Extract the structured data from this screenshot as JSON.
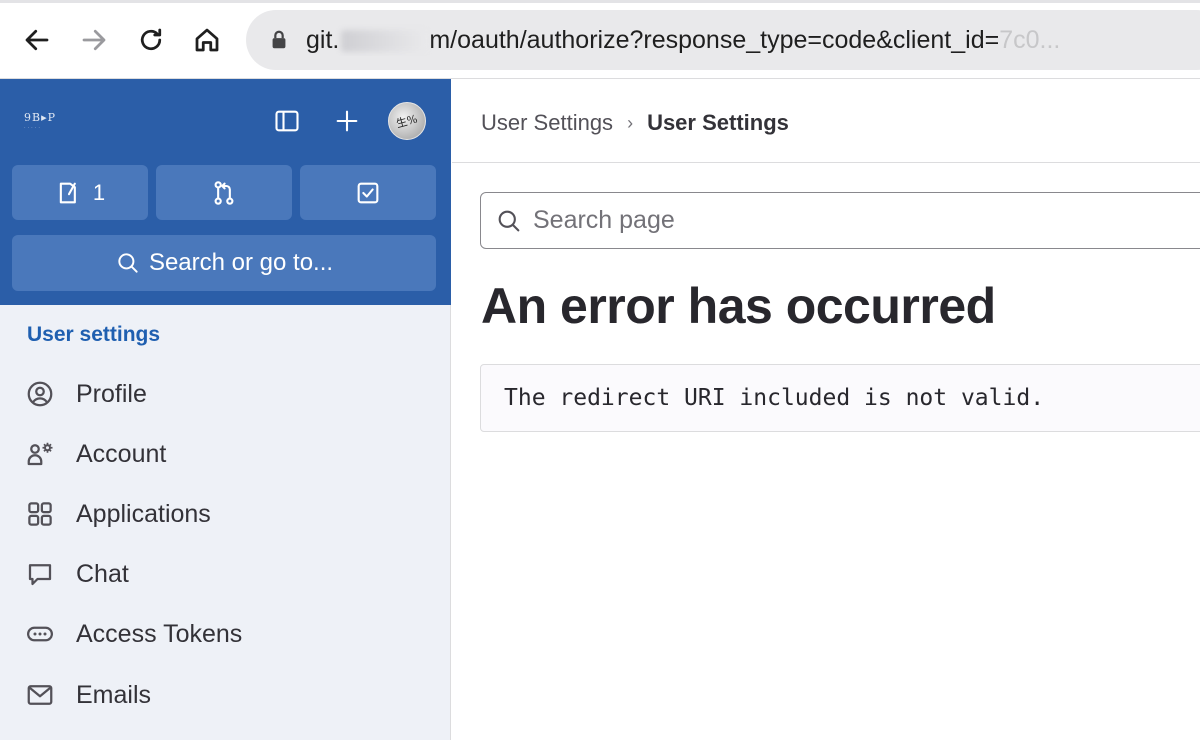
{
  "browser": {
    "url_host": "git.",
    "url_path": "m/oauth/authorize?response_type=code&client_id=",
    "url_tail": "7c0..."
  },
  "sidebar": {
    "logo_text": "9B▸P",
    "counters": [
      {
        "icon": "issues-icon",
        "count": "1"
      },
      {
        "icon": "merge-requests-icon",
        "count": ""
      },
      {
        "icon": "todos-icon",
        "count": ""
      }
    ],
    "search_label": "Search or go to...",
    "section_title": "User settings",
    "items": [
      {
        "label": "Profile",
        "icon": "profile-icon"
      },
      {
        "label": "Account",
        "icon": "account-icon"
      },
      {
        "label": "Applications",
        "icon": "applications-icon"
      },
      {
        "label": "Chat",
        "icon": "chat-icon"
      },
      {
        "label": "Access Tokens",
        "icon": "access-tokens-icon"
      },
      {
        "label": "Emails",
        "icon": "emails-icon"
      }
    ]
  },
  "main": {
    "breadcrumb": {
      "parent": "User Settings",
      "current": "User Settings"
    },
    "search_placeholder": "Search page",
    "error_title": "An error has occurred",
    "error_message": "The redirect URI included is not valid."
  },
  "colors": {
    "sidebar_header": "#2b5ea8",
    "sidebar_button": "#4a78bb",
    "section_title": "#1f5fb0",
    "sidebar_bg": "#eef1f7"
  }
}
